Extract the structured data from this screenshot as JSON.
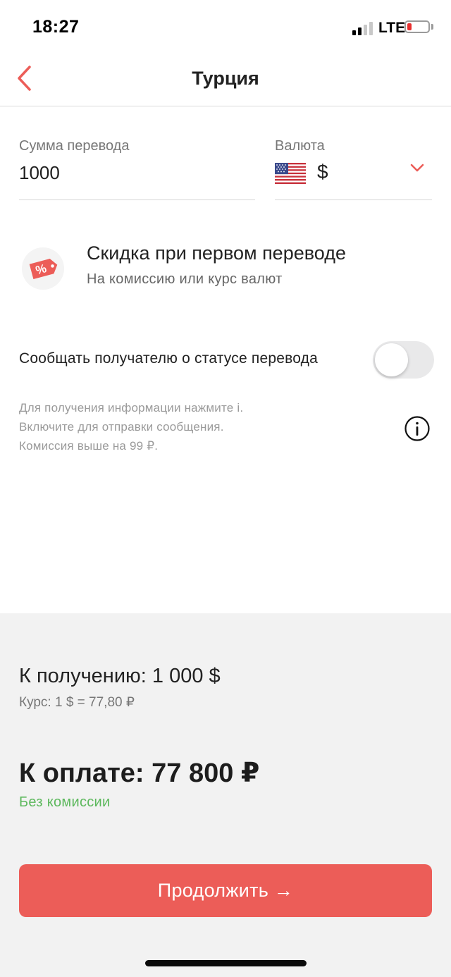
{
  "status_bar": {
    "time": "18:27",
    "network": "LTE",
    "battery_level": 0.15,
    "signal_bars_active": 2
  },
  "header": {
    "title": "Турция",
    "back_icon": "chevron-left-icon"
  },
  "form": {
    "amount": {
      "label": "Сумма перевода",
      "value": "1000"
    },
    "currency": {
      "label": "Валюта",
      "flag_icon": "us-flag-icon",
      "symbol": "$",
      "dropdown_icon": "chevron-down-icon"
    }
  },
  "promo": {
    "icon": "discount-tag-icon",
    "title": "Скидка при первом переводе",
    "subtitle": "На комиссию или курс валют"
  },
  "notify": {
    "label": "Сообщать получателю о статусе перевода",
    "enabled": false,
    "notes": [
      "Для получения информации нажмите i.",
      "Включите для отправки сообщения.",
      "Комиссия выше на 99 ₽."
    ],
    "info_icon": "info-icon"
  },
  "summary": {
    "receive": "К получению: 1 000 $",
    "rate": "Курс: 1 $ = 77,80 ₽",
    "pay": "К оплате: 77 800 ₽",
    "fee": "Без комиссии"
  },
  "actions": {
    "continue_label": "Продолжить →"
  },
  "colors": {
    "accent": "#ec5d58",
    "success": "#5cb85c",
    "panel": "#f2f2f2"
  }
}
